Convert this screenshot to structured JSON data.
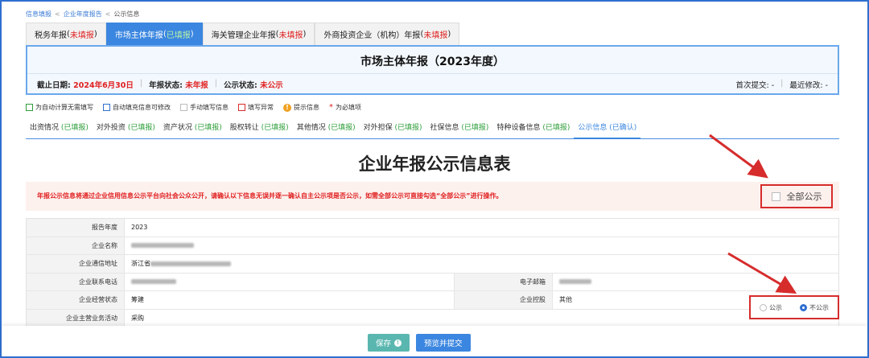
{
  "breadcrumb": [
    "信息填报",
    "企业年度报告",
    "公示信息"
  ],
  "tabs": [
    {
      "name": "税务年报",
      "status": "未填报",
      "active": false
    },
    {
      "name": "市场主体年报",
      "status": "已填报",
      "active": true
    },
    {
      "name": "海关管理企业年报",
      "status": "未填报",
      "active": false
    },
    {
      "name": "外商投资企业（机构）年报",
      "status": "未填报",
      "active": false
    }
  ],
  "header": {
    "title": "市场主体年报（2023年度）",
    "deadline_label": "截止日期:",
    "deadline_value": "2024年6月30日",
    "annual_status_label": "年报状态:",
    "annual_status_value": "未年报",
    "publicity_status_label": "公示状态:",
    "publicity_status_value": "未公示",
    "first_submit": "首次提交: -",
    "last_modified": "最近修改: -"
  },
  "legend": [
    {
      "label": "为自动计算无需填写",
      "color": "#2e9e3a"
    },
    {
      "label": "自动填充信息可修改",
      "color": "#2f6fcf"
    },
    {
      "label": "手动填写信息",
      "color": "#bbbbbb"
    },
    {
      "label": "填写异常",
      "color": "#d62c2c"
    },
    {
      "label": "提示信息",
      "icon": "warning-icon"
    },
    {
      "label": "为必填项",
      "icon": "asterisk-icon"
    }
  ],
  "subtabs": [
    {
      "name": "出资情况",
      "status": "(已填报)"
    },
    {
      "name": "对外投资",
      "status": "(已填报)"
    },
    {
      "name": "资产状况",
      "status": "(已填报)"
    },
    {
      "name": "股权转让",
      "status": "(已填报)"
    },
    {
      "name": "其他情况",
      "status": "(已填报)"
    },
    {
      "name": "对外担保",
      "status": "(已填报)"
    },
    {
      "name": "社保信息",
      "status": "(已填报)"
    },
    {
      "name": "特种设备信息",
      "status": "(已填报)"
    },
    {
      "name": "公示信息",
      "status": "(已确认)",
      "active": true
    }
  ],
  "main_title": "企业年报公示信息表",
  "notice": "年报公示信息将通过企业信用信息公示平台向社会公众公开，请确认以下信息无误并逐一确认自主公示项是否公示，如需全部公示可直接勾选“全部公示”进行操作。",
  "all_public_label": "全部公示",
  "table": {
    "report_year_label": "报告年度",
    "report_year_value": "2023",
    "company_name_label": "企业名称",
    "address_label": "企业通信地址",
    "address_prefix": "浙江省",
    "phone_label": "企业联系电话",
    "email_label": "电子邮箱",
    "status_label": "企业经营状态",
    "status_value": "筹建",
    "holding_label": "企业控股",
    "holding_value": "其他",
    "partial_label": "企业主营业务活动",
    "partial_value": "采购"
  },
  "radio": {
    "public": "公示",
    "not_public": "不公示",
    "selected": "not_public"
  },
  "footer": {
    "save": "保存",
    "preview_submit": "预览并提交"
  }
}
